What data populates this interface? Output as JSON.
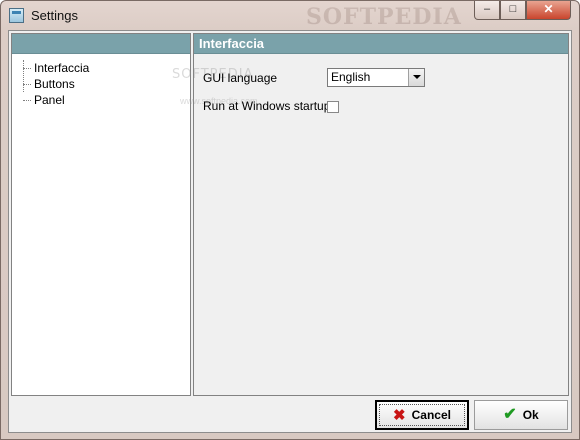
{
  "window": {
    "title": "Settings",
    "watermark": "SOFTPEDIA",
    "minimize_glyph": "–",
    "maximize_glyph": "□",
    "close_glyph": "✕"
  },
  "sidebar": {
    "items": [
      {
        "label": "Interfaccia"
      },
      {
        "label": "Buttons"
      },
      {
        "label": "Panel"
      }
    ]
  },
  "main": {
    "title": "Interfaccia",
    "gui_language": {
      "label": "GUI language",
      "value": "English"
    },
    "run_at_startup": {
      "label": "Run at Windows startup",
      "checked": false
    },
    "watermark_small": "SOFTPEDIA",
    "watermark_url": "www.softpedia.com"
  },
  "buttons": {
    "cancel_label": "Cancel",
    "ok_label": "Ok",
    "cancel_icon": "✖",
    "ok_icon": "✔"
  },
  "colors": {
    "header_bg": "#7aa2aa",
    "close_red": "#c9452d"
  }
}
